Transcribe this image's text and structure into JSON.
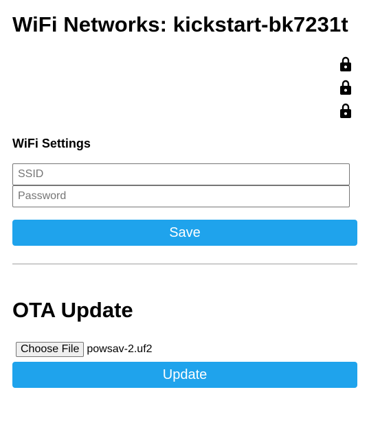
{
  "page": {
    "title": "WiFi Networks: kickstart-bk7231t"
  },
  "networks": [
    {
      "icon": "lock-icon"
    },
    {
      "icon": "lock-icon"
    },
    {
      "icon": "lock-icon"
    }
  ],
  "wifi_settings": {
    "heading": "WiFi Settings",
    "ssid": {
      "value": "",
      "placeholder": "SSID"
    },
    "password": {
      "value": "",
      "placeholder": "Password"
    },
    "save_label": "Save"
  },
  "ota": {
    "heading": "OTA Update",
    "choose_file_label": "Choose File",
    "file_name": "powsav-2.uf2",
    "update_label": "Update"
  },
  "colors": {
    "button_bg": "#1fa3ec",
    "button_text": "#ffffff"
  }
}
